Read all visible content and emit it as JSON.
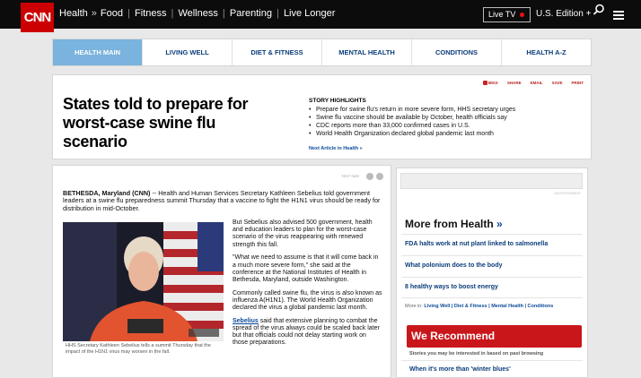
{
  "topbar": {
    "logo": "CNN",
    "section": "Health",
    "crumb_sep": "»",
    "nav": [
      "Food",
      "Fitness",
      "Wellness",
      "Parenting",
      "Live Longer"
    ],
    "live_tv": "Live TV",
    "edition": "U.S. Edition +"
  },
  "tabs": [
    {
      "label": "HEALTH MAIN",
      "active": true
    },
    {
      "label": "LIVING WELL",
      "active": false
    },
    {
      "label": "DIET & FITNESS",
      "active": false
    },
    {
      "label": "MENTAL HEALTH",
      "active": false
    },
    {
      "label": "CONDITIONS",
      "active": false
    },
    {
      "label": "HEALTH A-Z",
      "active": false
    }
  ],
  "story": {
    "headline": "States told to prepare for worst-case swine flu scenario",
    "tools": [
      "MIXX",
      "SHARE",
      "EMAIL",
      "SAVE",
      "PRINT"
    ],
    "highlights_title": "STORY HIGHLIGHTS",
    "highlights": [
      "Prepare for swine flu's return in more severe form, HHS secretary urges",
      "Swine flu vaccine should be available by October, health officials say",
      "CDC reports more than 33,000 confirmed cases in U.S.",
      "World Health Organization declared global pandemic last month"
    ],
    "next_article": "Next Article in Health »"
  },
  "article": {
    "text_size_label": "TEXT SIZE",
    "dateline": "BETHESDA, Maryland (CNN)",
    "lead": " -- Health and Human Services Secretary Kathleen Sebelius told government leaders at a swine flu preparedness summit Thursday that a vaccine to fight the H1N1 virus should be ready for distribution in mid-October.",
    "caption": "HHS Secretary Kathleen Sebelius tells a summit Thursday that the impact of the H1N1 virus may worsen in the fall.",
    "para1": "But Sebelius also advised 500 government, health and education leaders to plan for the worst-case scenario of the virus reappearing with renewed strength this fall.",
    "para2": "\"What we need to assume is that it will come back in a much more severe form,\" she said at the conference at the National Institutes of Health in Bethesda, Maryland, outside Washington.",
    "para3": "Commonly called swine flu, the virus is also known as influenza A(H1N1). The World Health Organization declared the virus a global pandemic last month.",
    "para4_link": "Sebelius",
    "para4_rest": " said that extensive planning to combat the spread of the virus always could be scaled back later but that officials could not delay starting work on those preparations."
  },
  "sidebar": {
    "ad_label": "ADVERTISEMENT",
    "more_title": "More from Health",
    "more_arrow": "»",
    "more_items": [
      "FDA halts work at nut plant linked to salmonella",
      "What polonium does to the body",
      "8 healthy ways to boost energy"
    ],
    "more_in_label": "More in:",
    "more_in_links": "Living Well | Diet & Fitness | Mental Health | Conditions",
    "recommend_title": "We Recommend",
    "recommend_sub": "Stories you may be interested in based on past browsing",
    "recommend_item": "When it's more than 'winter blues'"
  },
  "colors": {
    "brand_red": "#cc0000",
    "active_tab": "#7ab3dd",
    "link_blue": "#0a3d7a",
    "recommend_red": "#c9161a"
  }
}
